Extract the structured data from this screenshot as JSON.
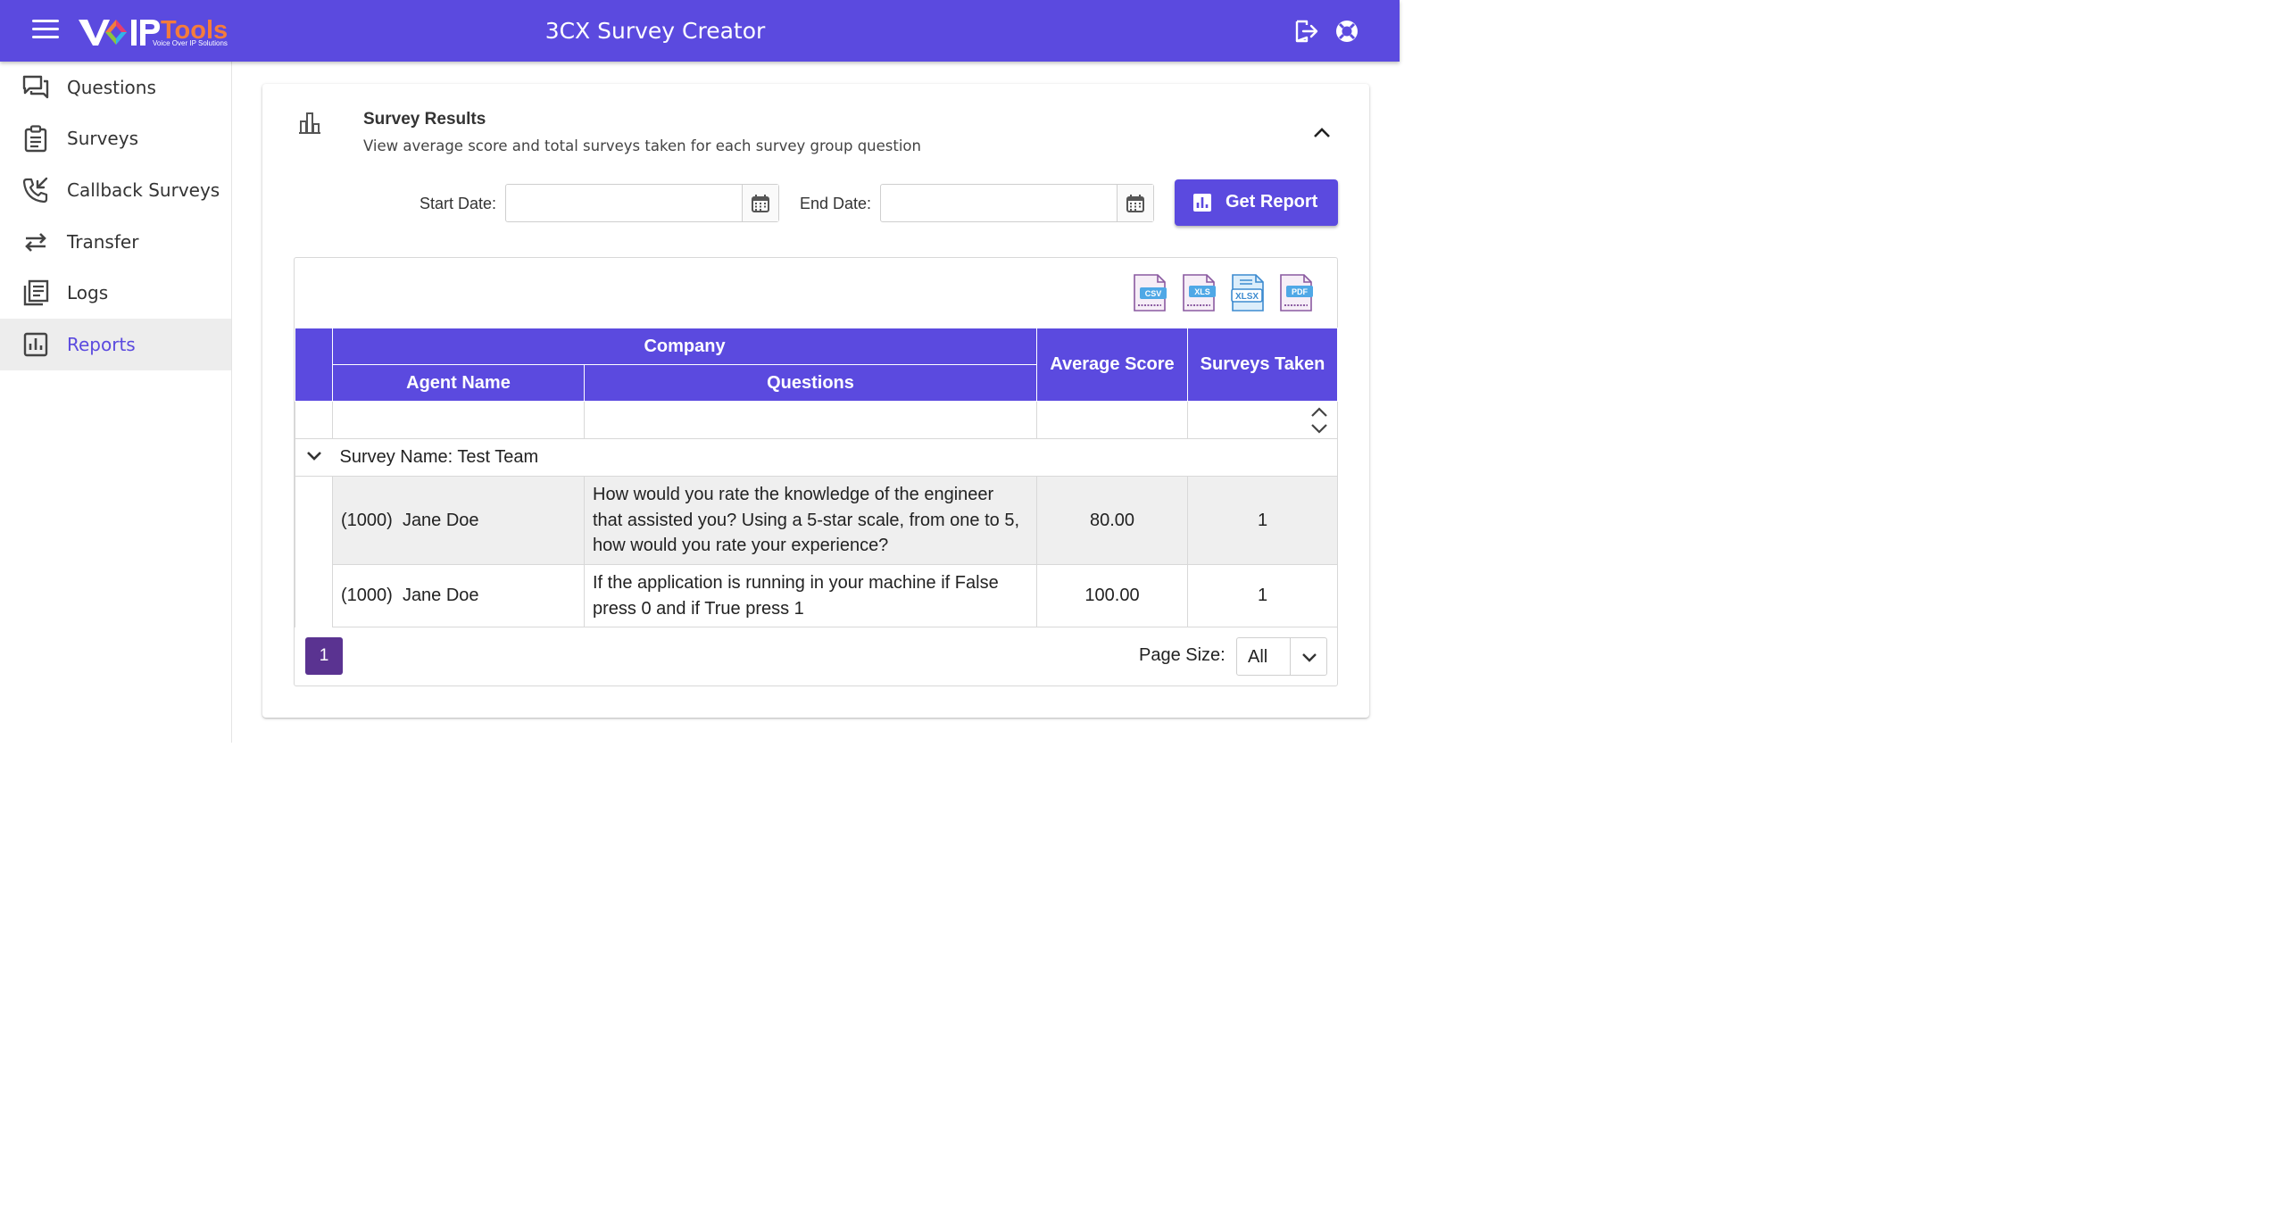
{
  "header": {
    "title": "3CX Survey Creator",
    "logo": {
      "text_a": "V",
      "text_b": "IP",
      "text_c": "Tools",
      "tagline": "Voice Over IP Solutions"
    },
    "icons": [
      "menu-icon",
      "logout-icon",
      "help-lifebuoy-icon"
    ]
  },
  "sidebar": {
    "items": [
      {
        "label": "Questions",
        "icon": "chat-bubbles-icon",
        "active": false
      },
      {
        "label": "Surveys",
        "icon": "clipboard-icon",
        "active": false
      },
      {
        "label": "Callback Surveys",
        "icon": "callback-phone-icon",
        "active": false
      },
      {
        "label": "Transfer",
        "icon": "transfer-arrows-icon",
        "active": false
      },
      {
        "label": "Logs",
        "icon": "logs-list-icon",
        "active": false
      },
      {
        "label": "Reports",
        "icon": "bar-chart-icon",
        "active": true
      }
    ]
  },
  "card": {
    "title": "Survey Results",
    "subtitle": "View average score and total surveys taken for each survey group question",
    "start_label": "Start Date:",
    "end_label": "End Date:",
    "start_value": "",
    "end_value": "",
    "report_button": "Get Report"
  },
  "grid": {
    "export_formats": [
      "CSV",
      "XLS",
      "XLSX",
      "PDF"
    ],
    "headers": {
      "company": "Company",
      "agent": "Agent Name",
      "questions": "Questions",
      "avg": "Average Score",
      "taken": "Surveys Taken"
    },
    "group_label": "Survey Name: Test Team",
    "rows": [
      {
        "ext": "(1000)",
        "agent": "Jane Doe",
        "question": "How would you rate the knowledge of the engineer that assisted you? Using a 5-star scale, from one to 5, how would you rate your experience?",
        "avg": "80.00",
        "taken": "1"
      },
      {
        "ext": "(1000)",
        "agent": "Jane Doe",
        "question": "If the application is running in your machine if False press 0 and if True press 1",
        "avg": "100.00",
        "taken": "1"
      }
    ],
    "page": "1",
    "page_size_label": "Page Size:",
    "page_size_value": "All"
  },
  "colors": {
    "primary": "#5b4adf",
    "pager": "#5a3391",
    "logo_accent": "#f47c3c"
  }
}
